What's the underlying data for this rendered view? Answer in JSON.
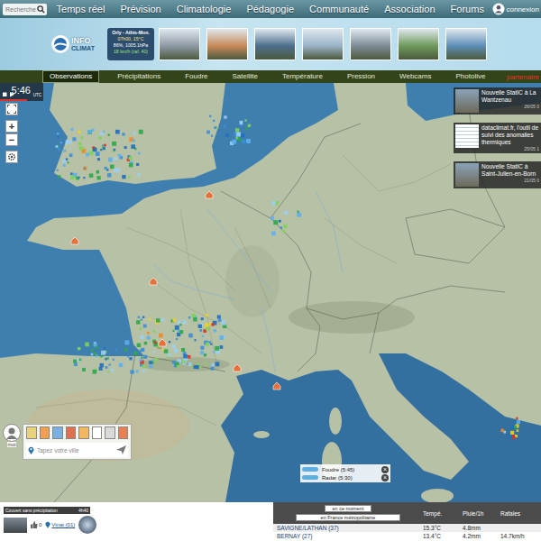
{
  "nav": {
    "search_placeholder": "Recherche",
    "items": [
      {
        "label": "Temps réel"
      },
      {
        "label": "Prévision"
      },
      {
        "label": "Climatologie"
      },
      {
        "label": "Pédagogie"
      },
      {
        "label": "Communauté"
      },
      {
        "label": "Association"
      },
      {
        "label": "Forums"
      }
    ],
    "login": "connexion"
  },
  "header": {
    "logo": [
      "INFO",
      "CLIMAT"
    ],
    "station": {
      "name": "Orly - Athis-Mon.",
      "lines": [
        "07h00, 15°C",
        "86%, 1005.1hPa",
        "18 km/h (raf. 40)"
      ]
    },
    "photos": [
      {
        "color": "#8e9aa6"
      },
      {
        "color": "#c98a5a"
      },
      {
        "color": "#4d6f8e"
      },
      {
        "color": "#9bb4c9"
      },
      {
        "color": "#7f8c96"
      },
      {
        "color": "#6f9a5b"
      },
      {
        "color": "#5d8fb8"
      }
    ]
  },
  "tabs": [
    {
      "label": "Observations",
      "selected": true
    },
    {
      "label": "Précipitations",
      "selected": false
    },
    {
      "label": "Foudre",
      "selected": false
    },
    {
      "label": "Satellite",
      "selected": false
    },
    {
      "label": "Température",
      "selected": false
    },
    {
      "label": "Pression",
      "selected": false
    },
    {
      "label": "Webcams",
      "selected": false
    },
    {
      "label": "Photolive",
      "selected": false
    }
  ],
  "partner": "partenaire",
  "map": {
    "time": "5:46",
    "time_unit": "UTC",
    "zoom": [
      "+",
      "−"
    ],
    "news": [
      {
        "title": "Nouvelle StatIC à La Wantzenau",
        "date": "26/05 0"
      },
      {
        "title": "dataclimat.fr, l'outil de suivi des anomalies thermiques",
        "date": "25/05 1"
      },
      {
        "title": "Nouvelle StatIC à Saint-Julien-en-Born",
        "date": "21/05 0"
      }
    ],
    "locator": {
      "user_label": "moi",
      "city_placeholder": "Tapez votre ville"
    },
    "legend": [
      {
        "label": "Foudre (5:45)",
        "on": true
      },
      {
        "label": "Radar (5:30)",
        "on": true
      }
    ],
    "close": "×"
  },
  "bottom": {
    "observation": {
      "label": "Couvert sans précipitation",
      "time": "4h40",
      "likes": "0",
      "station": "Vinat (01)"
    },
    "ranking": {
      "period": "en ce moment",
      "area": "en France métropolitaine",
      "columns": [
        "Tempé.",
        "Pluie/1h",
        "Rafales"
      ],
      "rows": [
        {
          "name": "SAVIGNE/LATHAN (37)",
          "values": [
            "15.3°C",
            "4.8mm",
            ""
          ]
        },
        {
          "name": "BERNAY (27)",
          "values": [
            "13.4°C",
            "4.2mm",
            "14.7km/h"
          ]
        }
      ]
    }
  }
}
